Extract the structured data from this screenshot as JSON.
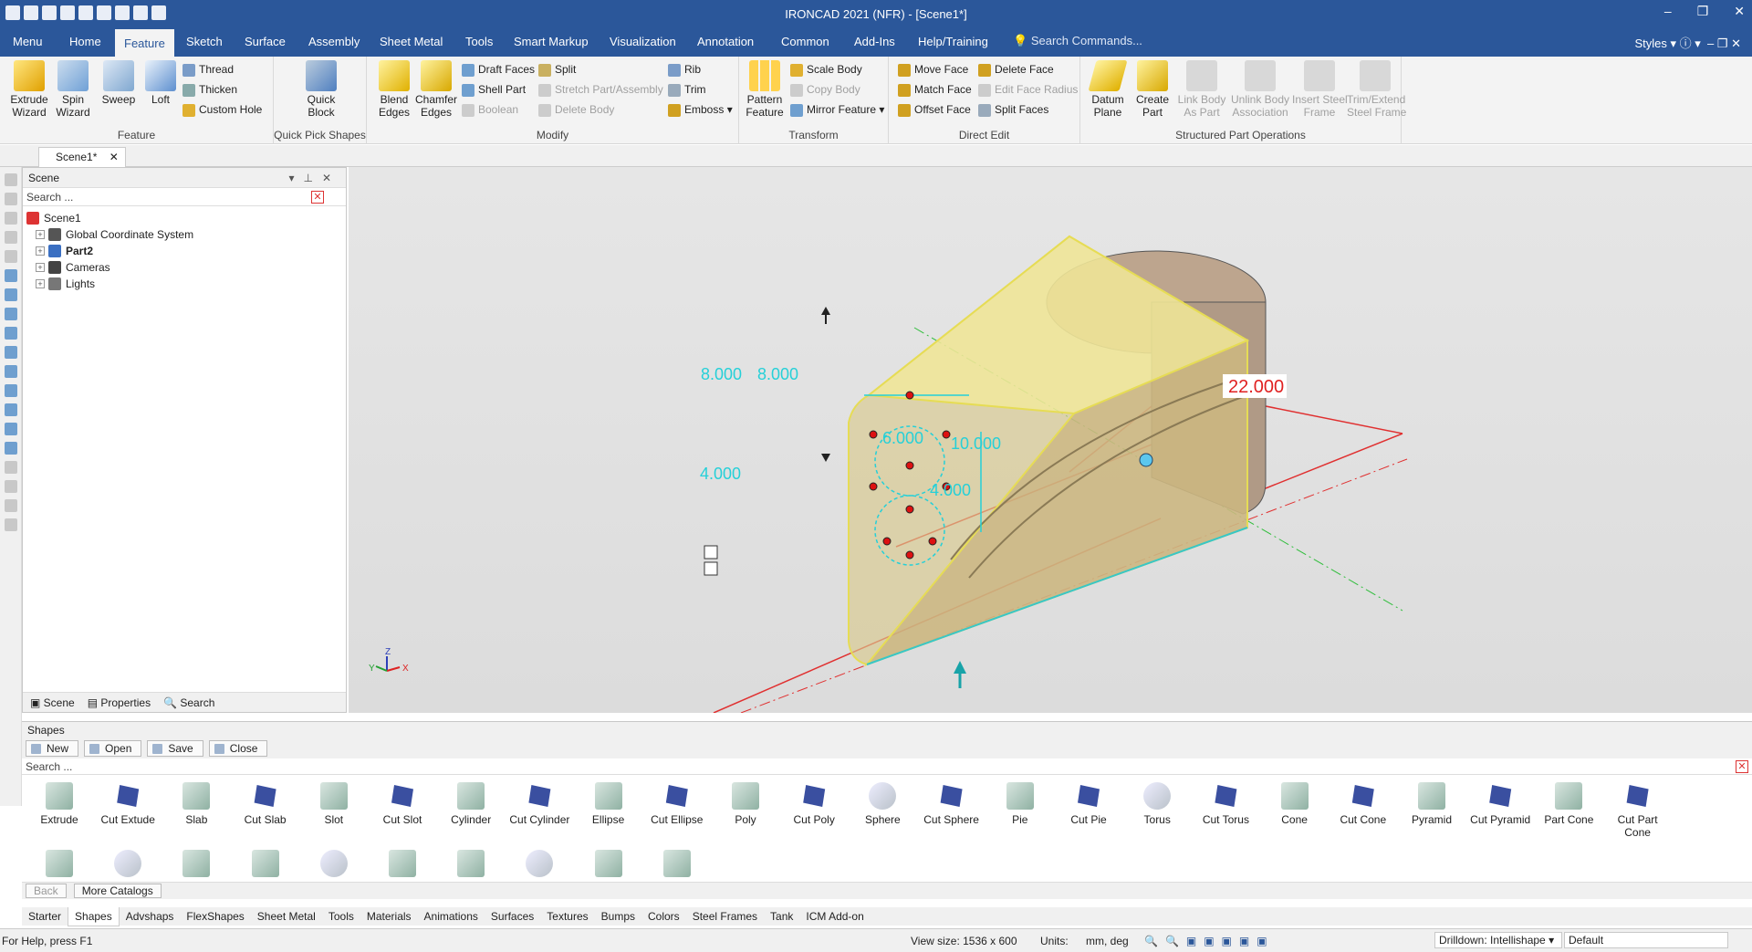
{
  "window": {
    "title": "IRONCAD 2021 (NFR) - [Scene1*]",
    "minimize": "–",
    "maximize": "❐",
    "close": "✕"
  },
  "menu_tabs": [
    "Menu",
    "Home",
    "Feature",
    "Sketch",
    "Surface",
    "Assembly",
    "Sheet Metal",
    "Tools",
    "Smart Markup",
    "Visualization",
    "Annotation",
    "Common",
    "Add-Ins",
    "Help/Training"
  ],
  "search_commands": "Search Commands...",
  "styles_label": "Styles",
  "ribbon": {
    "feature": {
      "label": "Feature",
      "extrude": "Extrude\nWizard",
      "spin": "Spin\nWizard",
      "sweep": "Sweep",
      "loft": "Loft",
      "thread": "Thread",
      "thicken": "Thicken",
      "custom_hole": "Custom Hole"
    },
    "quick_pick": {
      "label": "Quick Pick Shapes",
      "quick_block": "Quick\nBlock"
    },
    "modify": {
      "label": "Modify",
      "blend": "Blend\nEdges",
      "chamfer": "Chamfer\nEdges",
      "draft": "Draft Faces",
      "shell": "Shell Part",
      "boolean": "Boolean",
      "split": "Split",
      "stretch": "Stretch Part/Assembly",
      "delete_body": "Delete Body",
      "rib": "Rib",
      "trim": "Trim",
      "emboss": "Emboss"
    },
    "transform": {
      "label": "Transform",
      "pattern": "Pattern\nFeature",
      "scale": "Scale Body",
      "copy": "Copy Body",
      "mirror": "Mirror Feature"
    },
    "direct_edit": {
      "label": "Direct Edit",
      "move_face": "Move Face",
      "match_face": "Match Face",
      "offset_face": "Offset Face",
      "delete_face": "Delete Face",
      "edit_face_radius": "Edit Face Radius",
      "split_faces": "Split Faces"
    },
    "structured": {
      "label": "Structured Part Operations",
      "datum": "Datum\nPlane",
      "create_part": "Create\nPart",
      "link_body": "Link Body\nAs Part",
      "unlink_body": "Unlink Body\nAssociation",
      "insert_steel": "Insert Steel\nFrame",
      "trim_steel": "Trim/Extend\nSteel Frame"
    }
  },
  "doc_tab": "Scene1*",
  "scene_panel": {
    "title": "Scene",
    "search": "Search ...",
    "tree": [
      {
        "label": "Scene1",
        "bold": false
      },
      {
        "label": "Global Coordinate System",
        "bold": false
      },
      {
        "label": "Part2",
        "bold": true
      },
      {
        "label": "Cameras",
        "bold": false
      },
      {
        "label": "Lights",
        "bold": false
      }
    ],
    "footer_tabs": [
      "Scene",
      "Properties",
      "Search"
    ]
  },
  "viewport": {
    "dimensions": [
      "22.000",
      "8.000",
      "8.000",
      "10.000",
      "10.000",
      "4.000",
      "4.000",
      "6.000"
    ],
    "axes": {
      "x": "X",
      "y": "Y",
      "z": "Z"
    }
  },
  "shapes_panel": {
    "title": "Shapes",
    "toolbar": [
      "New",
      "Open",
      "Save",
      "Close"
    ],
    "search": "Search ...",
    "items": [
      {
        "label": "Extrude",
        "kind": "solid"
      },
      {
        "label": "Cut Extude",
        "kind": "cut"
      },
      {
        "label": "Slab",
        "kind": "solid"
      },
      {
        "label": "Cut Slab",
        "kind": "cut"
      },
      {
        "label": "Slot",
        "kind": "solid"
      },
      {
        "label": "Cut Slot",
        "kind": "cut"
      },
      {
        "label": "Cylinder",
        "kind": "solid"
      },
      {
        "label": "Cut Cylinder",
        "kind": "cut"
      },
      {
        "label": "Ellipse",
        "kind": "solid"
      },
      {
        "label": "Cut Ellipse",
        "kind": "cut"
      },
      {
        "label": "Poly",
        "kind": "solid"
      },
      {
        "label": "Cut Poly",
        "kind": "cut"
      },
      {
        "label": "Sphere",
        "kind": "gray"
      },
      {
        "label": "Cut Sphere",
        "kind": "cut"
      },
      {
        "label": "Pie",
        "kind": "solid"
      },
      {
        "label": "Cut Pie",
        "kind": "cut"
      },
      {
        "label": "Torus",
        "kind": "gray"
      },
      {
        "label": "Cut Torus",
        "kind": "cut"
      },
      {
        "label": "Cone",
        "kind": "solid"
      },
      {
        "label": "Cut Cone",
        "kind": "cut"
      },
      {
        "label": "Pyramid",
        "kind": "solid"
      },
      {
        "label": "Cut Pyramid",
        "kind": "cut"
      },
      {
        "label": "Part Cone",
        "kind": "solid"
      },
      {
        "label": "Cut Part\nCone",
        "kind": "cut"
      }
    ],
    "nav_back": "Back",
    "nav_more": "More Catalogs"
  },
  "catalog_tabs": [
    "Starter",
    "Shapes",
    "Advshaps",
    "FlexShapes",
    "Sheet Metal",
    "Tools",
    "Materials",
    "Animations",
    "Surfaces",
    "Textures",
    "Bumps",
    "Colors",
    "Steel Frames",
    "Tank",
    "ICM Add-on"
  ],
  "status": {
    "help": "For Help, press F1",
    "view_size": "View size: 1536 x  600",
    "units_label": "Units:",
    "units_value": "mm, deg",
    "drilldown": "Drilldown: Intellishape",
    "style": "Default"
  }
}
